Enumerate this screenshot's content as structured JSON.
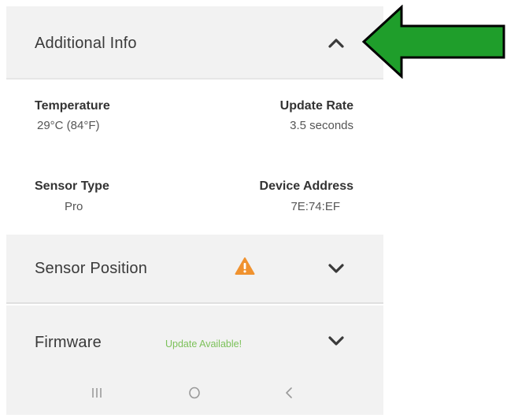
{
  "additional_info": {
    "title": "Additional Info",
    "expanded": true,
    "fields": {
      "temperature_label": "Temperature",
      "temperature_value": "29°C (84°F)",
      "update_rate_label": "Update Rate",
      "update_rate_value": "3.5 seconds",
      "sensor_type_label": "Sensor Type",
      "sensor_type_value": "Pro",
      "device_address_label": "Device Address",
      "device_address_value": "7E:74:EF"
    }
  },
  "sensor_position": {
    "title": "Sensor Position",
    "warning_icon": "warning-triangle-icon",
    "warning_color": "#f0922f"
  },
  "firmware": {
    "title": "Firmware",
    "status": "Update Available!",
    "status_color": "#7cc15a"
  },
  "navbar": {
    "recents_icon": "recents-icon",
    "home_icon": "home-icon",
    "back_icon": "back-icon"
  },
  "annotation": {
    "arrow_color": "#1f9e2b",
    "arrow_outline": "#000000"
  }
}
